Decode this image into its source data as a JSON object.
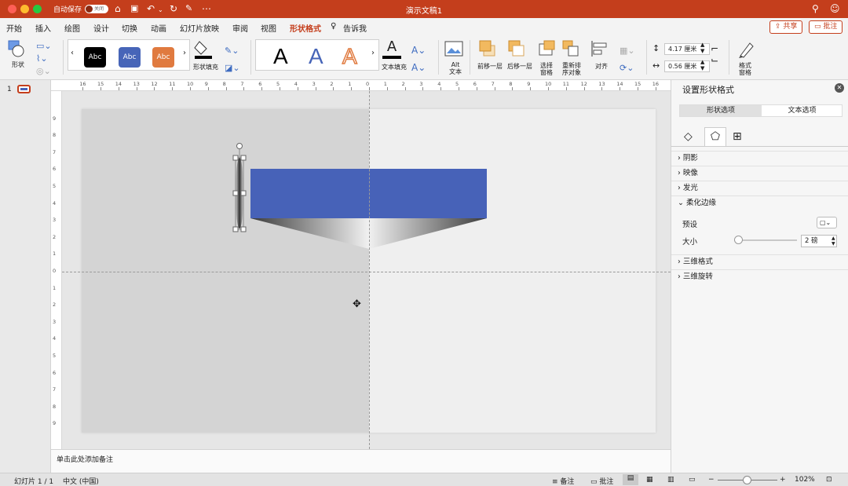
{
  "window": {
    "title": "演示文稿1",
    "autosave_label": "自动保存",
    "autosave_state": "关闭"
  },
  "tabs": [
    "开始",
    "插入",
    "绘图",
    "设计",
    "切换",
    "动画",
    "幻灯片放映",
    "审阅",
    "视图",
    "形状格式"
  ],
  "tell_me": "告诉我",
  "share_label": "共享",
  "comments_label": "批注",
  "ribbon": {
    "shape_label": "形状",
    "style_abc": "Abc",
    "shape_fill_label": "形状填充",
    "wordart_letter": "A",
    "text_fill_label": "文本填充",
    "alt_text_line1": "Alt",
    "alt_text_line2": "文本",
    "bring_forward": "前移一层",
    "send_backward": "后移一层",
    "selection_pane_line1": "选择",
    "selection_pane_line2": "窗格",
    "reorder_line1": "重新排",
    "reorder_line2": "序对象",
    "align": "对齐",
    "height_value": "4.17 厘米",
    "width_value": "0.56 厘米",
    "format_pane_line1": "格式",
    "format_pane_line2": "窗格"
  },
  "slide_number": "1",
  "ruler_labels": [
    "16",
    "15",
    "14",
    "13",
    "12",
    "11",
    "10",
    "9",
    "8",
    "7",
    "6",
    "5",
    "4",
    "3",
    "2",
    "1",
    "0",
    "1",
    "2",
    "3",
    "4",
    "5",
    "6",
    "7",
    "8",
    "9",
    "10",
    "11",
    "12",
    "13",
    "14",
    "15",
    "16"
  ],
  "vruler_labels": [
    "9",
    "8",
    "7",
    "6",
    "5",
    "4",
    "3",
    "2",
    "1",
    "0",
    "1",
    "2",
    "3",
    "4",
    "5",
    "6",
    "7",
    "8",
    "9"
  ],
  "notes_placeholder": "单击此处添加备注",
  "panel": {
    "title": "设置形状格式",
    "tab_shape": "形状选项",
    "tab_text": "文本选项",
    "sections": [
      "阴影",
      "映像",
      "发光",
      "柔化边缘"
    ],
    "preset_label": "预设",
    "size_label": "大小",
    "size_value": "2 磅",
    "sections_after": [
      "三维格式",
      "三维旋转"
    ],
    "soft_edge_slider_fraction": 0.02
  },
  "status": {
    "slide": "幻灯片 1 / 1",
    "language": "中文 (中国)",
    "notes": "备注",
    "comments": "批注",
    "zoom": "102%"
  },
  "colors": {
    "brand": "#c43e1c",
    "blue_rect": "#4762b8",
    "style_black": "#000000",
    "style_blue": "#4765b8",
    "style_orange": "#e07a3f"
  }
}
